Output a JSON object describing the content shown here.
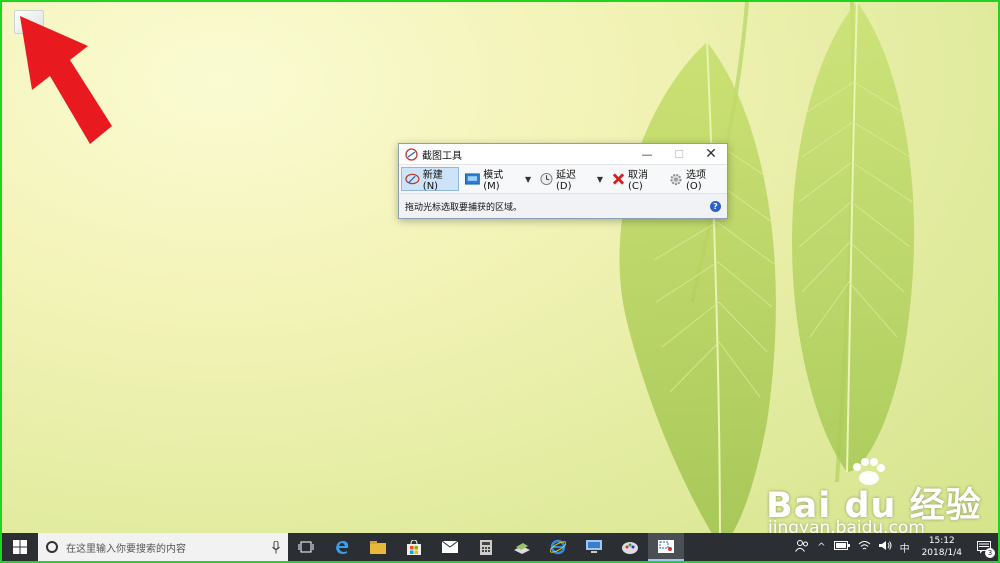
{
  "colors": {
    "border": "#21d421",
    "arrow": "#e8191f",
    "taskbar": "#2b2f34",
    "accent": "#2a63c8"
  },
  "desktop": {
    "icon": "computer-icon",
    "annotation": "red-arrow-icon"
  },
  "snipping_tool": {
    "title": "截图工具",
    "new_label": "新建(N)",
    "mode_label": "模式(M)",
    "delay_label": "延迟(D)",
    "cancel_label": "取消(C)",
    "options_label": "选项(O)",
    "status_text": "拖动光标选取要捕获的区域。"
  },
  "watermark": {
    "brand": "Bai du 经验",
    "url": "jingyan.baidu.com"
  },
  "taskbar": {
    "search_placeholder": "在这里输入你要搜索的内容",
    "ime": "中",
    "time": "15:12",
    "date": "2018/1/4",
    "notification_count": "3"
  }
}
